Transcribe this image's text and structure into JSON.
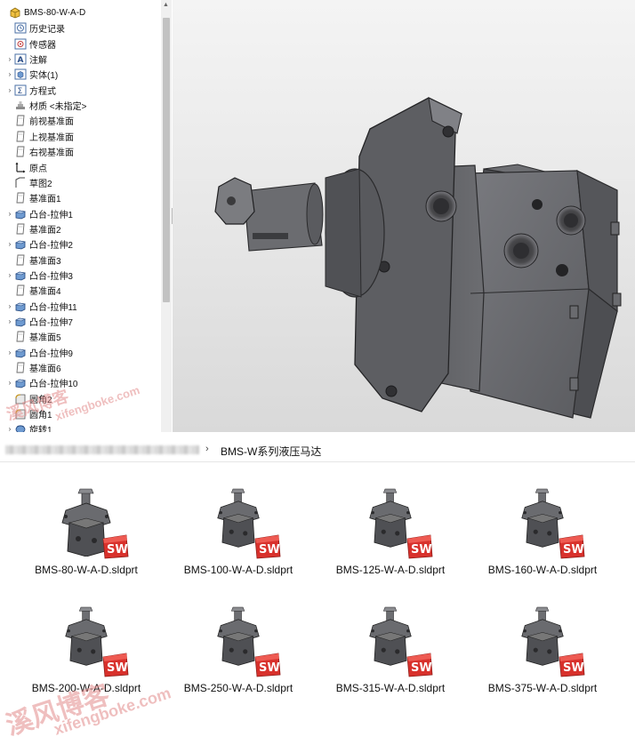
{
  "tree": {
    "root": "BMS-80-W-A-D",
    "items": [
      {
        "label": "历史记录",
        "icon": "history-icon",
        "arrow": false
      },
      {
        "label": "传感器",
        "icon": "sensor-icon",
        "arrow": false
      },
      {
        "label": "注解",
        "icon": "annotation-icon",
        "arrow": true
      },
      {
        "label": "实体(1)",
        "icon": "solid-body-icon",
        "arrow": true
      },
      {
        "label": "方程式",
        "icon": "equation-icon",
        "arrow": true
      },
      {
        "label": "材质 <未指定>",
        "icon": "material-icon",
        "arrow": false
      },
      {
        "label": "前视基准面",
        "icon": "plane-icon",
        "arrow": false
      },
      {
        "label": "上视基准面",
        "icon": "plane-icon",
        "arrow": false
      },
      {
        "label": "右视基准面",
        "icon": "plane-icon",
        "arrow": false
      },
      {
        "label": "原点",
        "icon": "origin-icon",
        "arrow": false
      },
      {
        "label": "草图2",
        "icon": "sketch-icon",
        "arrow": false
      },
      {
        "label": "基准面1",
        "icon": "plane-icon",
        "arrow": false
      },
      {
        "label": "凸台-拉伸1",
        "icon": "extrude-icon",
        "arrow": true
      },
      {
        "label": "基准面2",
        "icon": "plane-icon",
        "arrow": false
      },
      {
        "label": "凸台-拉伸2",
        "icon": "extrude-icon",
        "arrow": true
      },
      {
        "label": "基准面3",
        "icon": "plane-icon",
        "arrow": false
      },
      {
        "label": "凸台-拉伸3",
        "icon": "extrude-icon",
        "arrow": true
      },
      {
        "label": "基准面4",
        "icon": "plane-icon",
        "arrow": false
      },
      {
        "label": "凸台-拉伸11",
        "icon": "extrude-icon",
        "arrow": true
      },
      {
        "label": "凸台-拉伸7",
        "icon": "extrude-icon",
        "arrow": true
      },
      {
        "label": "基准面5",
        "icon": "plane-icon",
        "arrow": false
      },
      {
        "label": "凸台-拉伸9",
        "icon": "extrude-icon",
        "arrow": true
      },
      {
        "label": "基准面6",
        "icon": "plane-icon",
        "arrow": false
      },
      {
        "label": "凸台-拉伸10",
        "icon": "extrude-icon",
        "arrow": true
      },
      {
        "label": "圆角2",
        "icon": "fillet-icon",
        "arrow": false
      },
      {
        "label": "圆角1",
        "icon": "fillet-icon",
        "arrow": false
      },
      {
        "label": "旋转1",
        "icon": "revolve-icon",
        "arrow": true
      }
    ]
  },
  "explorer": {
    "breadcrumb_folder": "BMS-W系列液压马达",
    "files": [
      {
        "name": "BMS-80-W-A-D.sldprt"
      },
      {
        "name": "BMS-100-W-A-D.sldprt"
      },
      {
        "name": "BMS-125-W-A-D.sldprt"
      },
      {
        "name": "BMS-160-W-A-D.sldprt"
      },
      {
        "name": "BMS-200-W-A-D.sldprt"
      },
      {
        "name": "BMS-250-W-A-D.sldprt"
      },
      {
        "name": "BMS-315-W-A-D.sldprt"
      },
      {
        "name": "BMS-375-W-A-D.sldprt"
      }
    ]
  },
  "watermarks": {
    "cn": "溪风博客",
    "url": "xifengboke.com"
  },
  "colors": {
    "part_gray": "#5c5c60",
    "sw_red": "#d8312c"
  }
}
